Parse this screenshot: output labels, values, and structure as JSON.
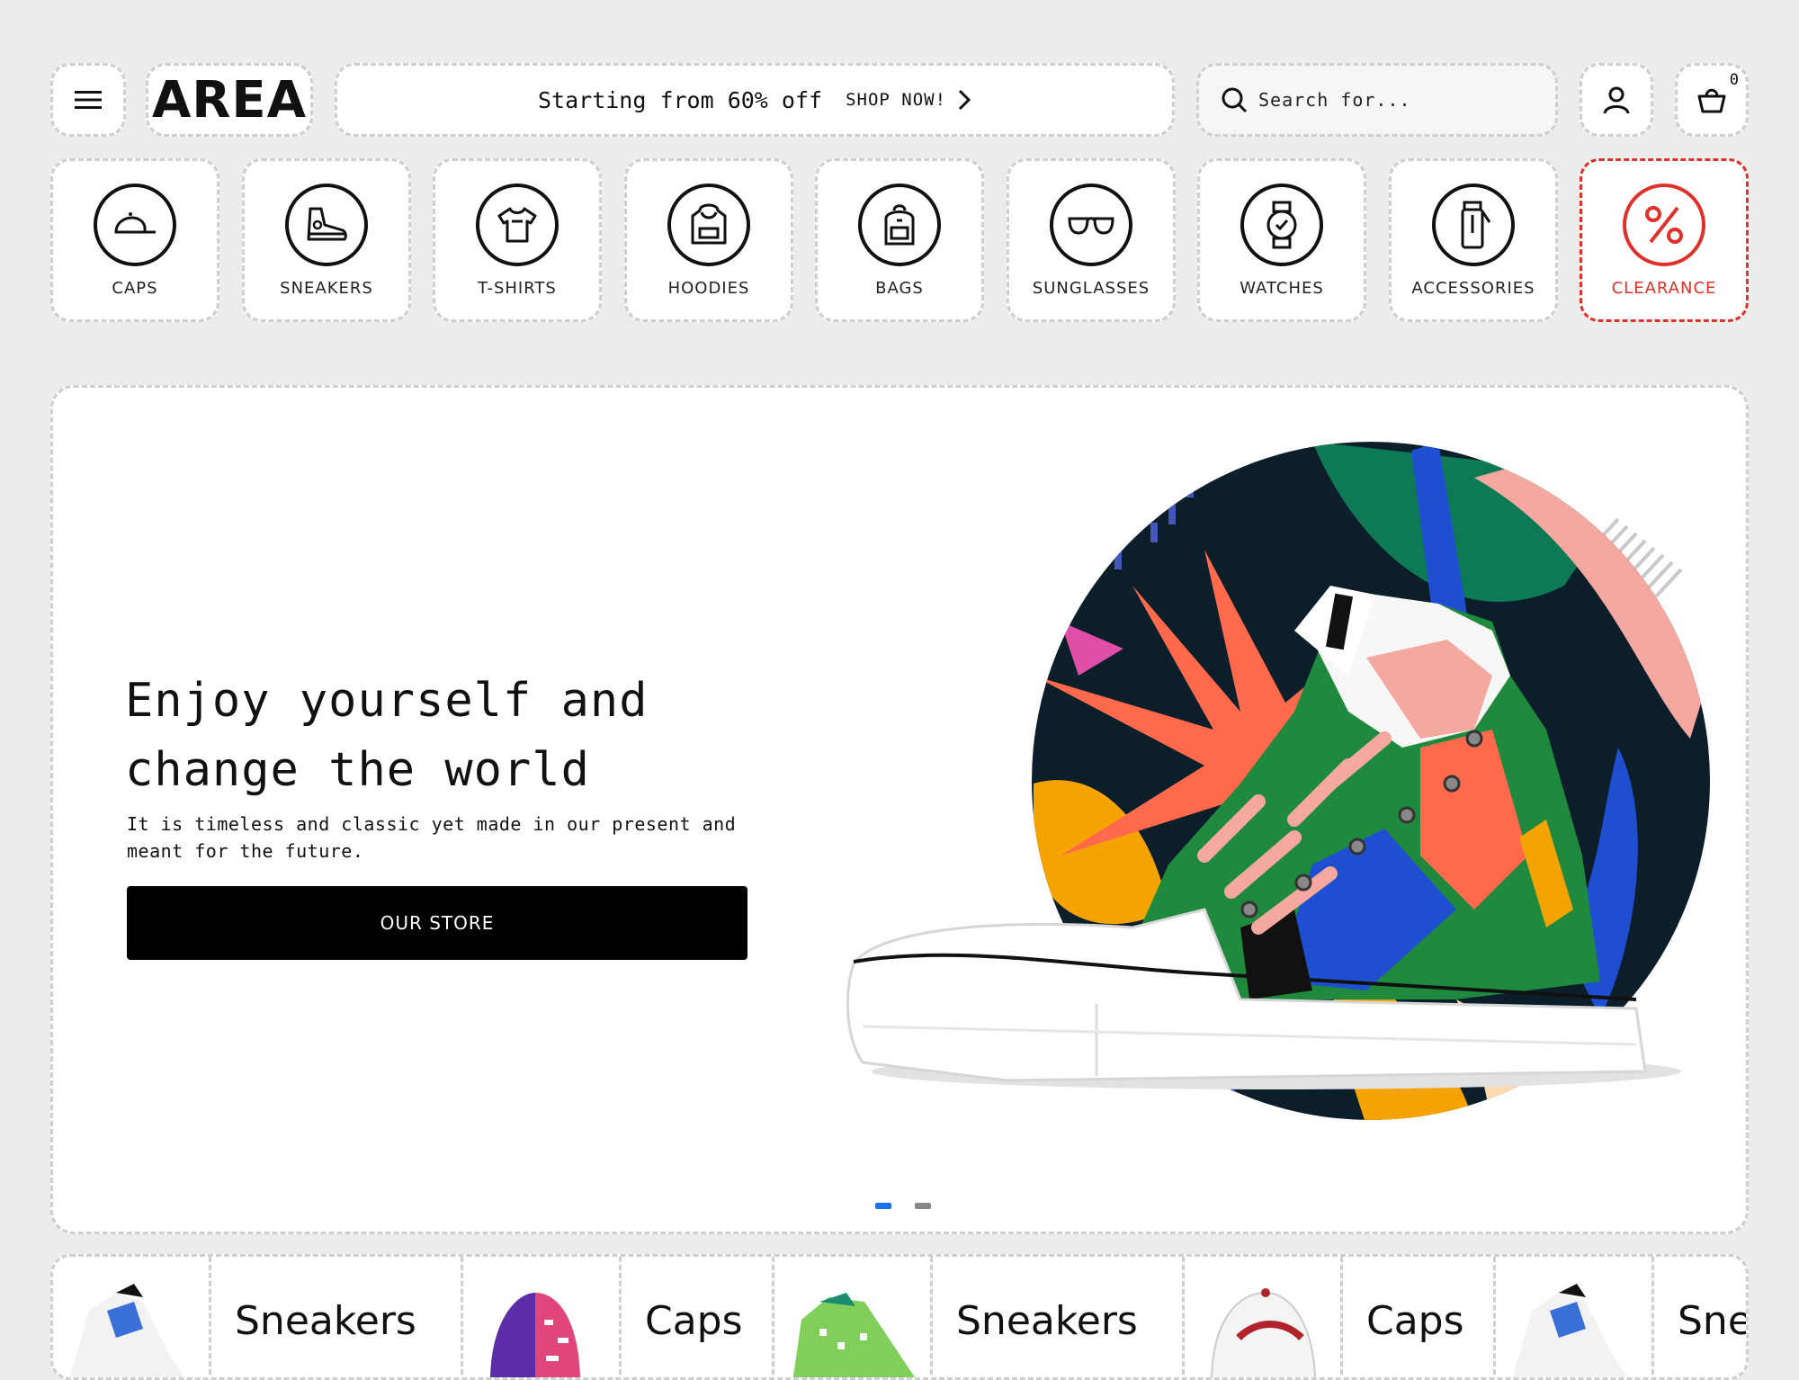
{
  "brand": {
    "logo": "AREA"
  },
  "promo": {
    "text": "Starting from 60% off",
    "cta": "SHOP NOW!"
  },
  "search": {
    "placeholder": "Search for..."
  },
  "cart": {
    "count": "0"
  },
  "categories": [
    {
      "label": "CAPS",
      "icon": "cap-icon"
    },
    {
      "label": "SNEAKERS",
      "icon": "sneaker-icon"
    },
    {
      "label": "T-SHIRTS",
      "icon": "tshirt-icon"
    },
    {
      "label": "HOODIES",
      "icon": "hoodie-icon"
    },
    {
      "label": "BAGS",
      "icon": "backpack-icon"
    },
    {
      "label": "SUNGLASSES",
      "icon": "sunglasses-icon"
    },
    {
      "label": "WATCHES",
      "icon": "watch-icon"
    },
    {
      "label": "ACCESSORIES",
      "icon": "bottle-icon"
    },
    {
      "label": "CLEARANCE",
      "icon": "percent-icon",
      "color": "#e0302a"
    }
  ],
  "hero": {
    "title_line1": "Enjoy yourself and",
    "title_line2": "change the world",
    "description": "It is timeless and classic yet made in our present and meant for the future.",
    "button": "OUR STORE",
    "active_slide": 1,
    "slides": 2,
    "active_dot_color": "#1a73e8"
  },
  "strip": {
    "items": [
      {
        "type": "image",
        "icon": "sneaker-thumb"
      },
      {
        "type": "text",
        "label": "Sneakers"
      },
      {
        "type": "image",
        "icon": "cap-thumb"
      },
      {
        "type": "text",
        "label": "Caps"
      },
      {
        "type": "image",
        "icon": "sneaker-thumb"
      },
      {
        "type": "text",
        "label": "Sneakers"
      },
      {
        "type": "image",
        "icon": "cap-thumb"
      },
      {
        "type": "text",
        "label": "Caps"
      },
      {
        "type": "image",
        "icon": "sneaker-thumb"
      },
      {
        "type": "text",
        "label": "Sne"
      }
    ]
  }
}
